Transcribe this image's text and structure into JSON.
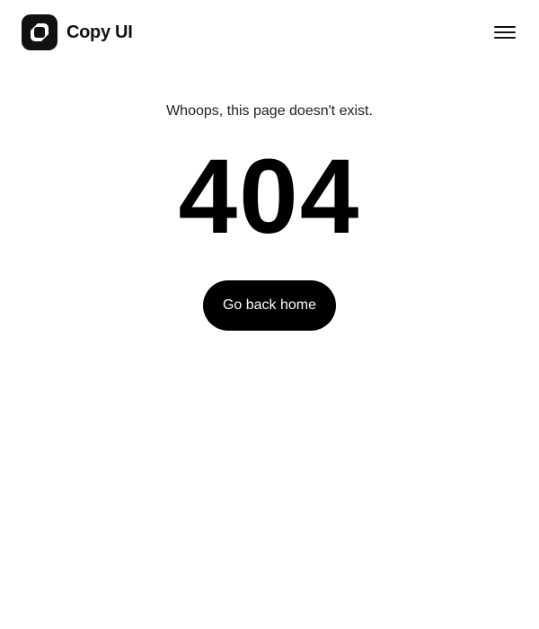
{
  "header": {
    "brand_name": "Copy UI",
    "logo_icon": "copy-ui-logo-icon",
    "menu_icon": "hamburger-menu-icon"
  },
  "main": {
    "message": "Whoops, this page doesn't exist.",
    "error_code": "404",
    "home_button_label": "Go back home"
  },
  "colors": {
    "background": "#ffffff",
    "text": "#111111",
    "button_background": "#000000",
    "button_text": "#ffffff"
  }
}
